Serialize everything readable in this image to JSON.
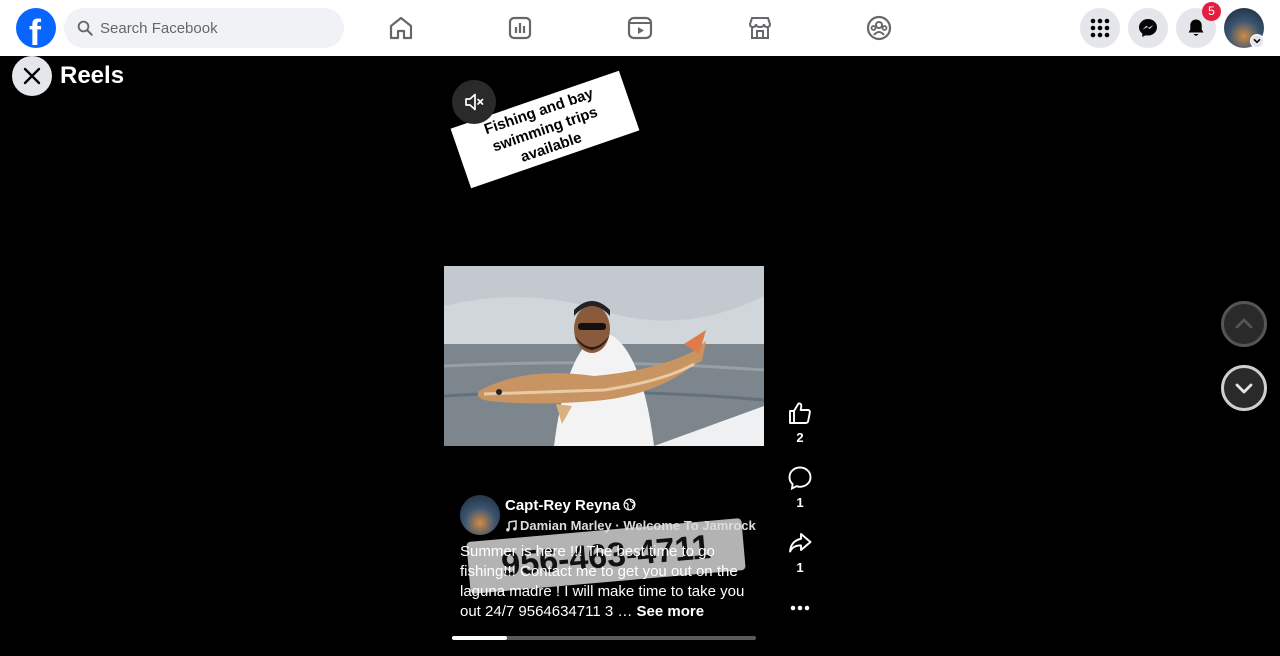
{
  "header": {
    "logo": "facebook-logo",
    "search": {
      "placeholder": "Search Facebook",
      "value": ""
    },
    "nav": [
      "home-icon",
      "stats-icon",
      "video-icon",
      "marketplace-icon",
      "groups-icon"
    ],
    "actions": [
      "menu-grid-icon",
      "messenger-icon",
      "bell-icon"
    ],
    "notification_count": "5"
  },
  "reels": {
    "title": "Reels",
    "sticker_text": "Fishing and bay swimming trips available",
    "phone_sticker": "956-463-4711",
    "author": "Capt-Rey Reyna",
    "music": "Damian Marley · Welcome To Jamrock",
    "caption": "Summer is here !!! The best time to go fishing!!! Contact me to get you out on the laguna madre ! I will make time to take you out 24/7 9564634711 3 …",
    "see_more": "See more",
    "likes": "2",
    "comments": "1",
    "shares": "1",
    "progress": 0.18
  },
  "colors": {
    "brand": "#0866ff",
    "badge": "#e41e3f"
  }
}
